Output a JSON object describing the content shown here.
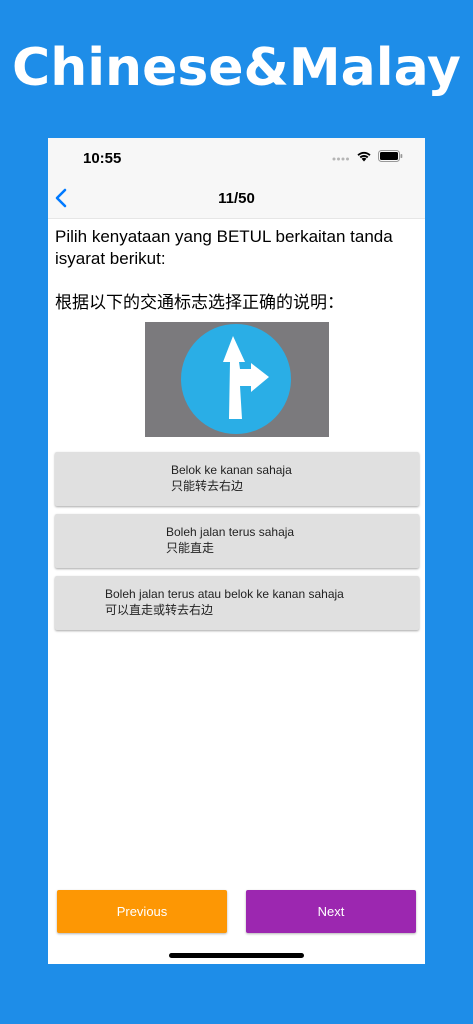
{
  "banner": {
    "title": "Chinese&Malay"
  },
  "status_bar": {
    "time": "10:55"
  },
  "nav": {
    "progress": "11/50"
  },
  "question": {
    "malay": "Pilih kenyataan yang BETUL berkaitan tanda isyarat berikut:",
    "chinese": "根据以下的交通标志选择正确的说明："
  },
  "sign": {
    "icon": "straight-or-right-arrow-sign-icon",
    "circle_color": "#2aaee6",
    "background_color": "#7b7a7d"
  },
  "options": [
    {
      "malay": "Belok ke kanan sahaja",
      "chinese": "只能转去右边"
    },
    {
      "malay": "Boleh jalan terus sahaja",
      "chinese": "只能直走"
    },
    {
      "malay": "Boleh jalan terus atau belok ke kanan sahaja",
      "chinese": "可以直走或转去右边"
    }
  ],
  "buttons": {
    "previous": "Previous",
    "next": "Next",
    "previous_color": "#fd9704",
    "next_color": "#9c27b0"
  },
  "colors": {
    "background": "#1e8de8",
    "accent": "#007aff"
  }
}
